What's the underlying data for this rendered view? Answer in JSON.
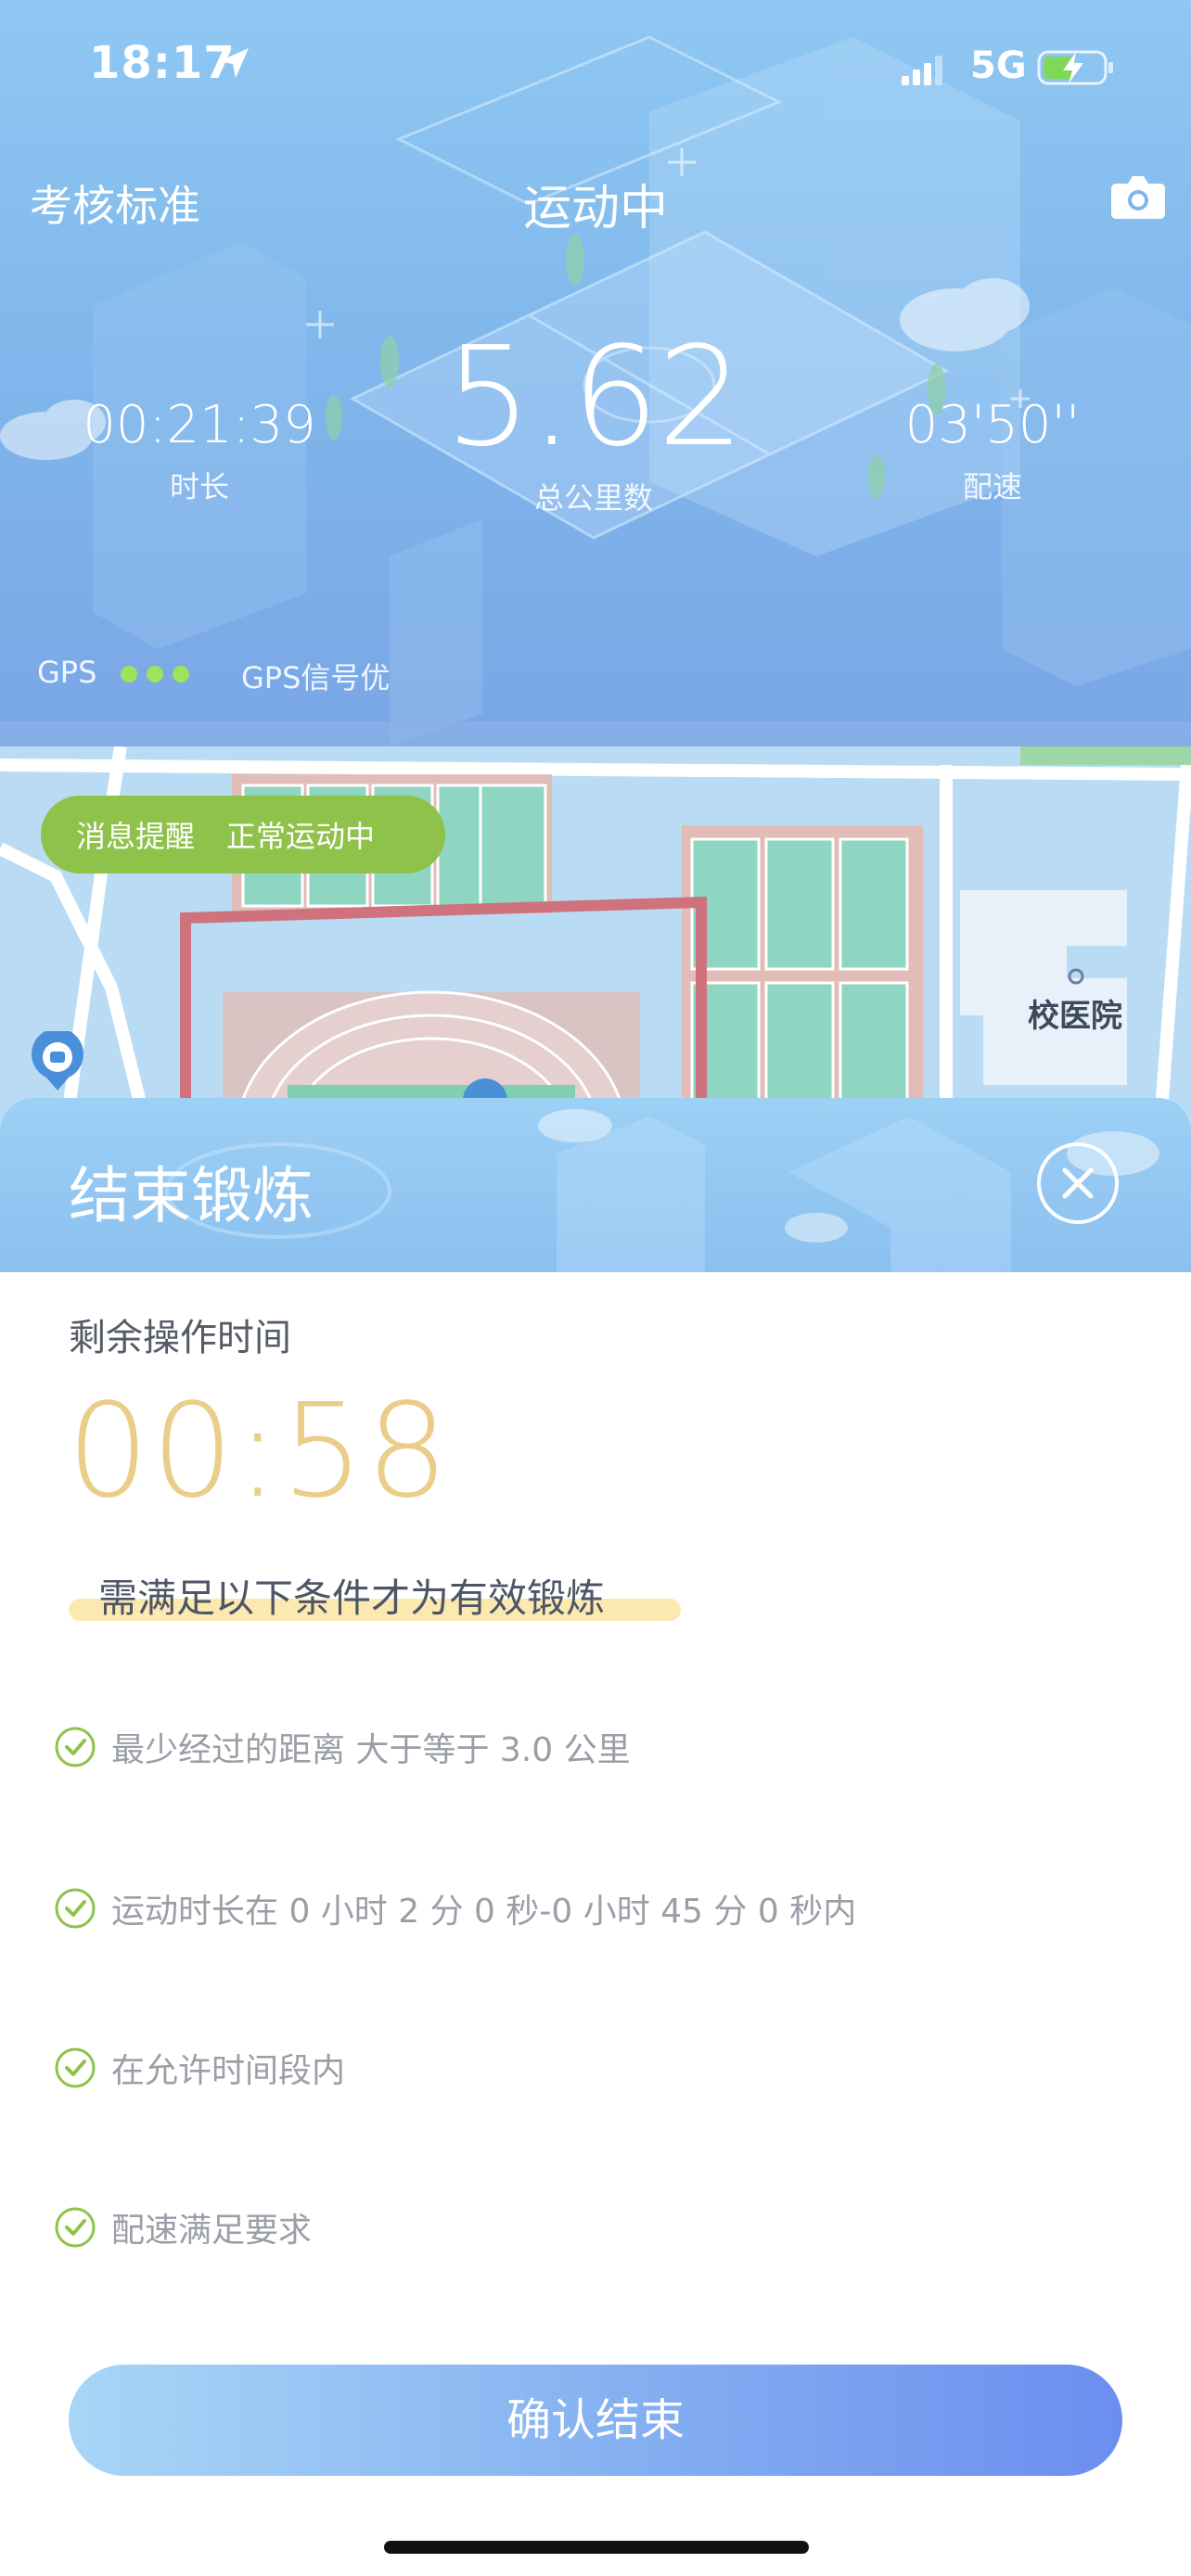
{
  "status_bar": {
    "time": "18:17",
    "network": "5G"
  },
  "header": {
    "left_link": "考核标准",
    "title": "运动中",
    "metrics": {
      "duration": {
        "value": "00:21:39",
        "label": "时长"
      },
      "distance": {
        "value": "5.62",
        "label": "总公里数"
      },
      "pace": {
        "value": "03'50''",
        "label": "配速"
      }
    },
    "gps": {
      "label": "GPS",
      "signal_level": 3,
      "status": "GPS信号优"
    }
  },
  "map": {
    "message_tag": "消息提醒",
    "message_text": "正常运动中",
    "place_label": "校医院"
  },
  "sheet": {
    "title": "结束锻炼",
    "remaining_label": "剩余操作时间",
    "countdown": "00:58",
    "conditions_title": "需满足以下条件才为有效锻炼",
    "conditions": [
      {
        "text": "最少经过的距离 大于等于  3.0 公里",
        "met": true
      },
      {
        "text": "运动时长在 0 小时 2 分 0 秒-0 小时 45 分 0 秒内",
        "met": true
      },
      {
        "text": "在允许时间段内",
        "met": true
      },
      {
        "text": "配速满足要求",
        "met": true
      }
    ],
    "confirm_label": "确认结束"
  },
  "colors": {
    "accent_green": "#8fc24a",
    "countdown_gold": "#ebcd8a",
    "button_gradient_start": "#a8d6f6",
    "button_gradient_end": "#6c8ef0"
  }
}
